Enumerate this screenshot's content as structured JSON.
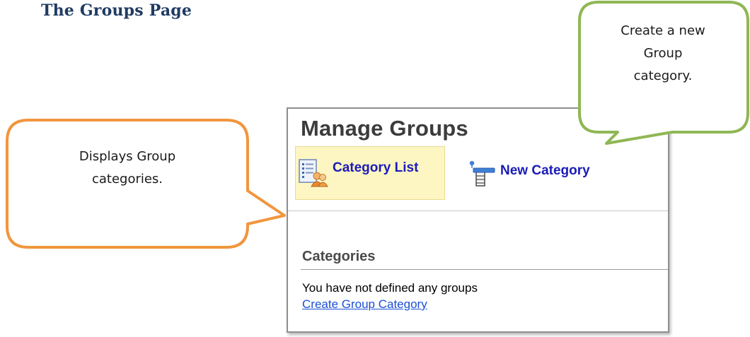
{
  "heading": "The Groups Page",
  "panel": {
    "title": "Manage Groups",
    "tabs": [
      {
        "label": "Category List",
        "icon": "category-list-icon",
        "active": true
      },
      {
        "label": "New Category",
        "icon": "new-category-icon",
        "active": false
      }
    ],
    "section_title": "Categories",
    "empty_message": "You have not defined any groups",
    "create_link": "Create Group Category"
  },
  "callouts": {
    "left": {
      "line1": "Displays Group",
      "line2": "categories.",
      "border_color": "#f0963e"
    },
    "right": {
      "line1": "Create a new",
      "line2": "Group",
      "line3": "category.",
      "border_color": "#8fb754"
    }
  },
  "colors": {
    "heading": "#1f3b63",
    "link": "#1a4fd6",
    "tab_link": "#1b1bb8",
    "active_tab_bg": "#fdf6c3"
  }
}
